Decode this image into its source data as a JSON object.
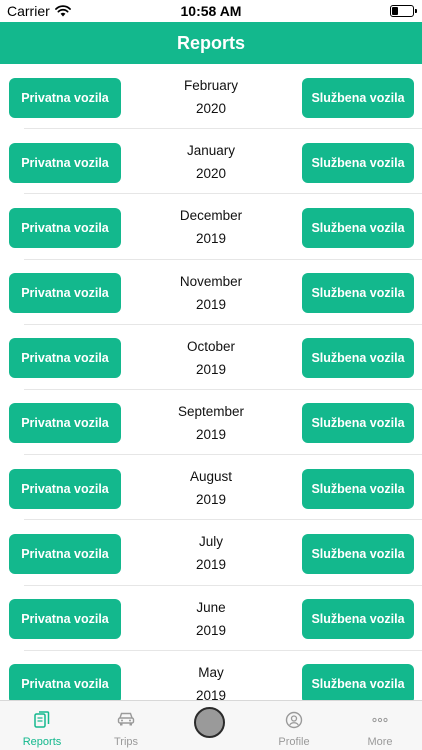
{
  "status_bar": {
    "carrier": "Carrier",
    "time": "10:58 AM",
    "wifi_icon": "wifi-icon",
    "battery_icon": "battery-icon"
  },
  "header": {
    "title": "Reports"
  },
  "reports": {
    "left_button_label": "Privatna vozila",
    "right_button_label": "Službena vozila",
    "rows": [
      {
        "month": "February",
        "year": "2020"
      },
      {
        "month": "January",
        "year": "2020"
      },
      {
        "month": "December",
        "year": "2019"
      },
      {
        "month": "November",
        "year": "2019"
      },
      {
        "month": "October",
        "year": "2019"
      },
      {
        "month": "September",
        "year": "2019"
      },
      {
        "month": "August",
        "year": "2019"
      },
      {
        "month": "July",
        "year": "2019"
      },
      {
        "month": "June",
        "year": "2019"
      },
      {
        "month": "May",
        "year": "2019"
      }
    ]
  },
  "tab_bar": {
    "tabs": [
      {
        "label": "Reports",
        "icon": "reports-icon",
        "active": true
      },
      {
        "label": "Trips",
        "icon": "car-icon",
        "active": false
      },
      {
        "label": "",
        "icon": "center-circle-icon",
        "active": false
      },
      {
        "label": "Profile",
        "icon": "profile-icon",
        "active": false
      },
      {
        "label": "More",
        "icon": "more-icon",
        "active": false
      }
    ]
  },
  "colors": {
    "accent": "#13b88d",
    "tab_inactive": "#9a9a9a",
    "separator": "#e6e6e6"
  }
}
